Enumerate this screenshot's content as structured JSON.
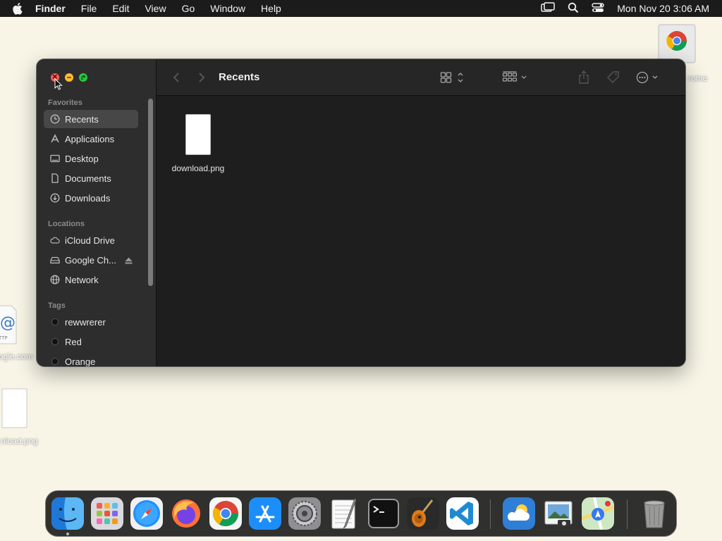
{
  "menubar": {
    "app_name": "Finder",
    "items": [
      "File",
      "Edit",
      "View",
      "Go",
      "Window",
      "Help"
    ],
    "clock": "Mon Nov 20  3:06 AM"
  },
  "desktop": {
    "icons": [
      {
        "label": "rome",
        "icon": "chrome-installer-icon"
      },
      {
        "label": "ogle.com",
        "icon": "http-location-icon"
      },
      {
        "label": "nload.png",
        "icon": "png-file-icon"
      }
    ]
  },
  "finder": {
    "title": "Recents",
    "sidebar": {
      "favorites_heading": "Favorites",
      "favorites": [
        {
          "label": "Recents",
          "icon": "clock-icon",
          "selected": true
        },
        {
          "label": "Applications",
          "icon": "applications-icon"
        },
        {
          "label": "Desktop",
          "icon": "desktop-icon"
        },
        {
          "label": "Documents",
          "icon": "document-icon"
        },
        {
          "label": "Downloads",
          "icon": "download-icon"
        }
      ],
      "locations_heading": "Locations",
      "locations": [
        {
          "label": "iCloud Drive",
          "icon": "cloud-icon"
        },
        {
          "label": "Google Ch...",
          "icon": "disk-icon"
        },
        {
          "label": "Network",
          "icon": "globe-icon"
        }
      ],
      "tags_heading": "Tags",
      "tags": [
        {
          "label": "rewwrerer",
          "color": "#111111"
        },
        {
          "label": "Red",
          "color": "#111111"
        },
        {
          "label": "Orange",
          "color": "#111111"
        }
      ]
    },
    "files": [
      {
        "name": "download.png",
        "icon": "png-file-icon"
      }
    ]
  },
  "dock": {
    "apps": [
      "Finder",
      "Launchpad",
      "Safari",
      "Firefox",
      "Google Chrome",
      "App Store",
      "System Settings",
      "TextEdit",
      "Terminal",
      "GarageBand",
      "Visual Studio Code",
      "Weather",
      "Preview",
      "Maps",
      "Trash"
    ]
  },
  "colors": {
    "desktop_bg": "#f8f5e6",
    "window_bg": "#1e1e1e",
    "sidebar_bg": "#2d2d2d",
    "close": "#fe5f57",
    "minimize": "#febc2e",
    "maximize": "#28c840"
  }
}
